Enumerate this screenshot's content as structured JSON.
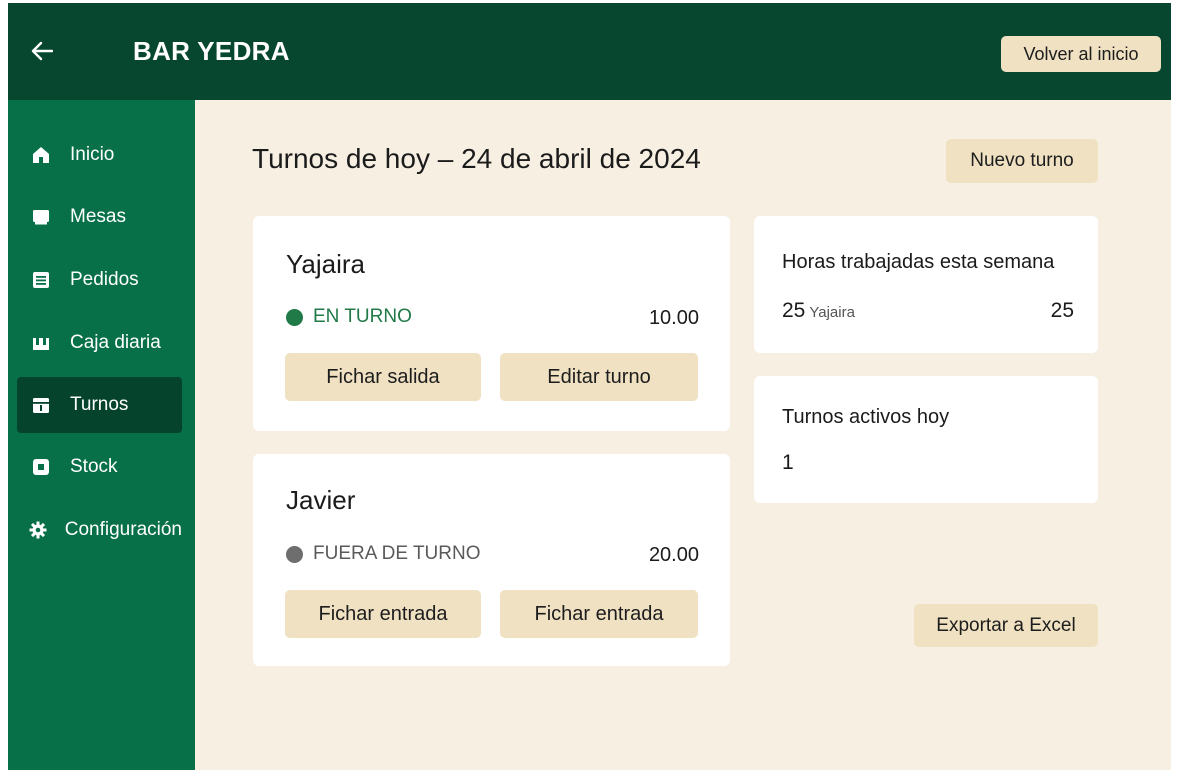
{
  "header": {
    "title": "BAR YEDRA",
    "home_button": "Volver al inicio"
  },
  "sidebar": {
    "items": [
      {
        "label": "Inicio",
        "icon": "home-icon"
      },
      {
        "label": "Mesas",
        "icon": "table-icon"
      },
      {
        "label": "Pedidos",
        "icon": "orders-icon"
      },
      {
        "label": "Caja diaria",
        "icon": "cash-register-icon"
      },
      {
        "label": "Turnos",
        "icon": "shifts-icon",
        "active": true
      },
      {
        "label": "Stock",
        "icon": "stock-icon"
      },
      {
        "label": "Configuración",
        "icon": "gear-icon"
      }
    ]
  },
  "main": {
    "title": "Turnos de hoy – 24 de abril de 2024",
    "new_shift_button": "Nuevo turno",
    "export_button": "Exportar a Excel"
  },
  "employees": [
    {
      "name": "Yajaira",
      "status": "EN TURNO",
      "status_color": "#1f7a47",
      "rate": "10.00",
      "buttons": [
        "Fichar salida",
        "Editar turno"
      ]
    },
    {
      "name": "Javier",
      "status": "FUERA DE TURNO",
      "status_color": "#6e6e6e",
      "rate": "20.00",
      "buttons": [
        "Fichar entrada",
        "Fichar entrada"
      ]
    }
  ],
  "stats": {
    "hours": {
      "title": "Horas trabajadas esta semana",
      "value": "25",
      "employee": "Yajaira",
      "total": "25"
    },
    "active": {
      "title": "Turnos activos hoy",
      "value": "1"
    }
  },
  "colors": {
    "header": "#07472f",
    "sidebar": "#087049",
    "sidebar_active": "#05432c",
    "background": "#f6efe2",
    "button": "#efe1c2"
  }
}
